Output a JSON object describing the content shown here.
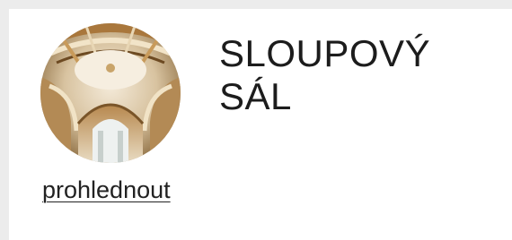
{
  "card": {
    "title_line1": "SLOUPOVÝ",
    "title_line2": "SÁL",
    "link_label": "prohlednout",
    "thumbnail_icon": "vaulted-hall-photo"
  },
  "colors": {
    "background": "#ececec",
    "card": "#ffffff",
    "text": "#1c1c1c"
  }
}
